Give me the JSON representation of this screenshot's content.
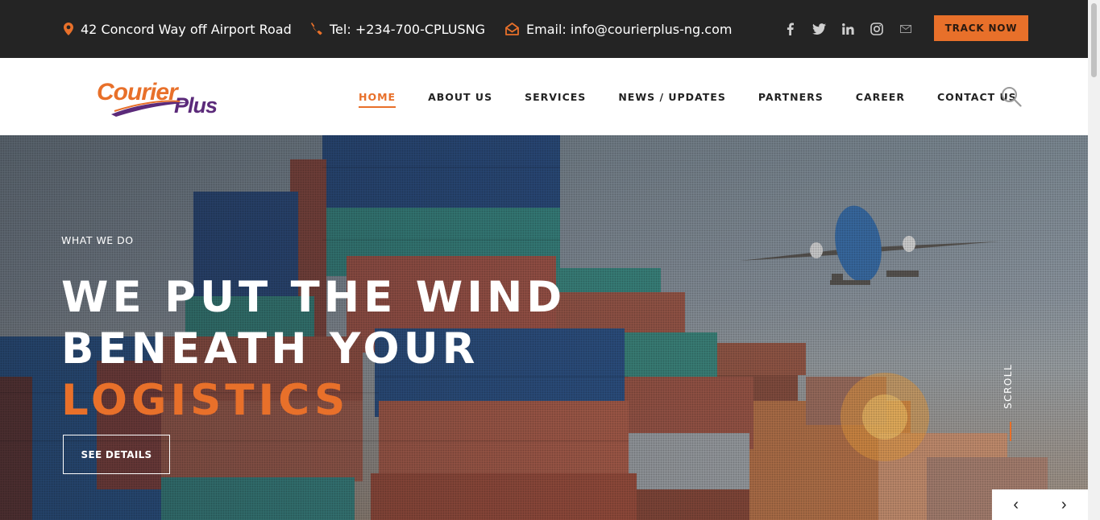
{
  "topbar": {
    "address": "42 Concord Way off Airport Road",
    "tel": "Tel: +234-700-CPLUSNG",
    "email": "Email: info@courierplus-ng.com",
    "social": [
      "facebook-icon",
      "twitter-icon",
      "linkedin-icon",
      "instagram-icon",
      "mail-icon"
    ],
    "track_label": "TRACK NOW"
  },
  "logo": {
    "word1": "Courier",
    "word2": "Plus"
  },
  "nav": {
    "items": [
      "HOME",
      "ABOUT US",
      "SERVICES",
      "NEWS / UPDATES",
      "PARTNERS",
      "CAREER",
      "CONTACT US"
    ],
    "active": "HOME"
  },
  "hero": {
    "eyebrow": "WHAT WE DO",
    "line1": "WE PUT THE WIND",
    "line2": "BENEATH YOUR",
    "line3": "LOGISTICS",
    "cta": "SEE DETAILS",
    "scroll": "SCROLL",
    "prev": "‹",
    "next": "›"
  },
  "colors": {
    "accent": "#e8702a",
    "topbar": "#242424",
    "logo_purple": "#5b2a7a"
  }
}
